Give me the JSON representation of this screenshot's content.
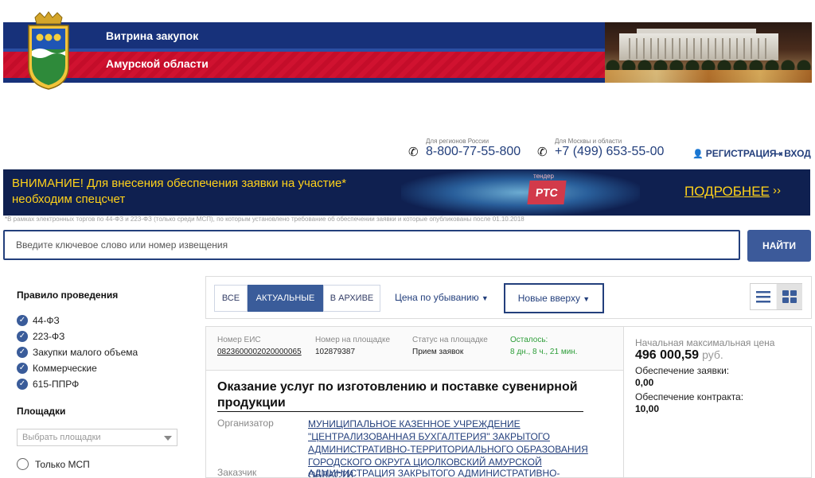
{
  "header": {
    "title_line1": "Витрина закупок",
    "title_line2": "Амурской области"
  },
  "phones": {
    "regions_caption": "Для регионов России",
    "regions_number": "8-800-77-55-800",
    "moscow_caption": "Для Москвы и области",
    "moscow_number": "+7 (499) 653-55-00"
  },
  "auth": {
    "register": "РЕГИСТРАЦИЯ",
    "login": "ВХОД"
  },
  "attention": {
    "message": "ВНИМАНИЕ! Для внесения обеспечения заявки на участие* необходим спецсчет",
    "more": "ПОДРОБНЕЕ",
    "more_arrow": "››",
    "tender": "тендер",
    "brand": "РТС"
  },
  "footnote": "*В рамках электронных торгов по 44-ФЗ и 223-ФЗ (только среди МСП), по которым установлено требование об обеспечении заявки и которые опубликованы после 01.10.2018",
  "search": {
    "placeholder": "Введите ключевое слово или номер извещения",
    "button": "НАЙТИ"
  },
  "sidebar": {
    "rules_heading": "Правило проведения",
    "rules": [
      "44-ФЗ",
      "223-ФЗ",
      "Закупки малого объема",
      "Коммерческие",
      "615-ППРФ"
    ],
    "platforms_heading": "Площадки",
    "platforms_placeholder": "Выбрать площадки",
    "only_msp": "Только МСП"
  },
  "filters": {
    "tabs": [
      "ВСЕ",
      "АКТУАЛЬНЫЕ",
      "В АРХИВЕ"
    ],
    "active_tab": "АКТУАЛЬНЫЕ",
    "sort_price": "Цена по убыванию",
    "sort_new": "Новые вверху"
  },
  "card": {
    "eis_label": "Номер ЕИС",
    "eis_value": "0823600002020000065",
    "platform_no_label": "Номер на площадке",
    "platform_no_value": "102879387",
    "status_label": "Статус на площадке",
    "status_value": "Прием заявок",
    "remaining_label": "Осталось:",
    "remaining_value": "8 дн., 8 ч., 21 мин.",
    "title": "Оказание услуг по изготовлению и поставке сувенирной продукции",
    "organizer_label": "Организатор",
    "organizer_value": "МУНИЦИПАЛЬНОЕ КАЗЕННОЕ УЧРЕЖДЕНИЕ \"ЦЕНТРАЛИЗОВАННАЯ БУХГАЛТЕРИЯ\" ЗАКРЫТОГО АДМИНИСТРАТИВНО-ТЕРРИТОРИАЛЬНОГО ОБРАЗОВАНИЯ ГОРОДСКОГО ОКРУГА ЦИОЛКОВСКИЙ АМУРСКОЙ ОБЛАСТИ",
    "customer_label": "Заказчик",
    "customer_value": "АДМИНИСТРАЦИЯ ЗАКРЫТОГО АДМИНИСТРАТИВНО-"
  },
  "price": {
    "label": "Начальная максимальная цена",
    "value": "496 000,59",
    "currency": "руб.",
    "bid_security_label": "Обеспечение заявки:",
    "bid_security_value": "0,00",
    "contract_security_label": "Обеспечение контракта:",
    "contract_security_value": "10,00"
  },
  "colors": {
    "brand_blue": "#233f7c",
    "banner_red": "#c8102e",
    "attention_yellow": "#ffd21a",
    "remaining_green": "#2e9e3a"
  }
}
